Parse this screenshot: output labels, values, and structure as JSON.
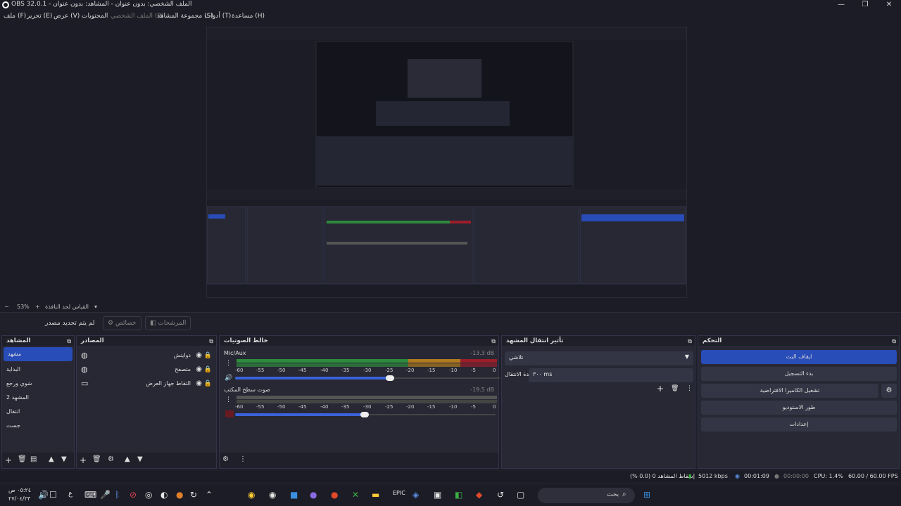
{
  "window": {
    "title": "OBS 32.0.1 - الملف الشخصي: بدون عنوان - المشاهد: بدون عنوان",
    "controls": [
      "—",
      "❐",
      "✕"
    ]
  },
  "menu": [
    {
      "label": "ملف (F)",
      "enabled": true
    },
    {
      "label": "تحرير (E)",
      "enabled": true
    },
    {
      "label": "عرض (V)",
      "enabled": true
    },
    {
      "label": "المحتويات",
      "enabled": true
    },
    {
      "label": "الملف الشخصي (P)",
      "enabled": false
    },
    {
      "label": "مجموعة المشاهد (S)",
      "enabled": true
    },
    {
      "label": "أدوات (T)",
      "enabled": true
    },
    {
      "label": "مساعدة (H)",
      "enabled": true
    }
  ],
  "zoom": {
    "minus": "−",
    "value": "53%",
    "plus": "+",
    "fit_label": "القياس لحد النافذة"
  },
  "source_bar": {
    "no_source": "لم يتم تحديد مصدر",
    "properties": "خصائص",
    "filters": "المرشحات"
  },
  "scenes": {
    "title": "المشاهد",
    "items": [
      "مشهد",
      "البداية",
      "شوي ورجع",
      "المشهد 2",
      "انتقال",
      "جست"
    ],
    "selected": 0
  },
  "sources": {
    "title": "المصادر",
    "items": [
      "دوايتش",
      "متصفح",
      "التقاط جهاز العرض"
    ]
  },
  "mixer": {
    "title": "خالط الصوتيات",
    "tracks": [
      {
        "name": "Mic/Aux",
        "db": "-13.3 dB",
        "level": 0.52,
        "volume": 0.6
      },
      {
        "name": "صوت سطح المكتب",
        "db": "-19.5 dB",
        "level": 0.4,
        "volume": 0.5
      }
    ],
    "ticks": [
      "-60",
      "-55",
      "-50",
      "-45",
      "-40",
      "-35",
      "-30",
      "-25",
      "-20",
      "-15",
      "-10",
      "-5",
      "0"
    ]
  },
  "transitions": {
    "title": "تأثير انتقال المشهد",
    "selected": "تلاشي",
    "duration_label": "مدة الانتقال",
    "duration_value": "٣٠٠ ms"
  },
  "controls": {
    "title": "التحكم",
    "buttons": [
      "ايقاف البث",
      "بدء التسجيل",
      "تشغيل الكاميرا الافتراضية",
      "طور الاستوديو",
      "إعدادات"
    ]
  },
  "status": {
    "dropped": "إسقاط المشاهد 0 (0.0 %)",
    "bitrate": "5012 kbps",
    "stream_time": "00:01:09",
    "record_time": "00:00:00",
    "cpu": "CPU: 1.4%",
    "fps": "60.00 / 60.00 FPS"
  },
  "taskbar": {
    "clock_time": "٠٥:٢٤ ص",
    "clock_date": "٢٧/٠٤/٢٣",
    "lang": "ع",
    "search_placeholder": "بحث"
  },
  "colors": {
    "accent": "#284cb8",
    "meter_green": "#2e8b3e",
    "meter_yellow": "#b07a1e",
    "meter_red": "#9b1e2a"
  }
}
